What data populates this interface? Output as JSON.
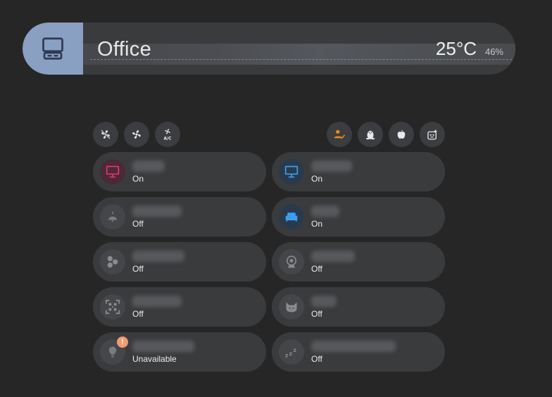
{
  "header": {
    "title": "Office",
    "temperature": "25°C",
    "humidity": "46%"
  },
  "quick_buttons": [
    {
      "icon": "fan-icon"
    },
    {
      "icon": "fan-alt-icon"
    },
    {
      "icon": "ac-fan-icon",
      "label": "A/C"
    },
    {
      "icon": "person-check-icon"
    },
    {
      "icon": "linux-icon"
    },
    {
      "icon": "apple-icon"
    },
    {
      "icon": "robot-icon"
    }
  ],
  "tiles": {
    "left": [
      {
        "icon": "monitor-icon",
        "state": "On",
        "color": "#e6336e"
      },
      {
        "icon": "ceiling-light-icon",
        "name": "Ceiling",
        "state": "Off"
      },
      {
        "icon": "hexagon-cluster-icon",
        "state": "Off"
      },
      {
        "icon": "qr-scan-icon",
        "state": "Off"
      },
      {
        "icon": "lightbulb-icon",
        "state": "Unavailable",
        "badge": "!"
      }
    ],
    "right": [
      {
        "icon": "monitor-icon",
        "state": "On",
        "color": "#3aa0f0"
      },
      {
        "icon": "sofa-icon",
        "state": "On",
        "color": "#3aa0f0"
      },
      {
        "icon": "webcam-icon",
        "state": "Off"
      },
      {
        "icon": "cat-icon",
        "state": "Off"
      },
      {
        "icon": "sleep-icon",
        "state": "Off"
      }
    ]
  },
  "colors": {
    "accent_blue": "#3aa0f0",
    "accent_pink": "#e6336e",
    "accent_orange": "#f08a1c",
    "header_icon_bg": "#8aa0c2"
  }
}
